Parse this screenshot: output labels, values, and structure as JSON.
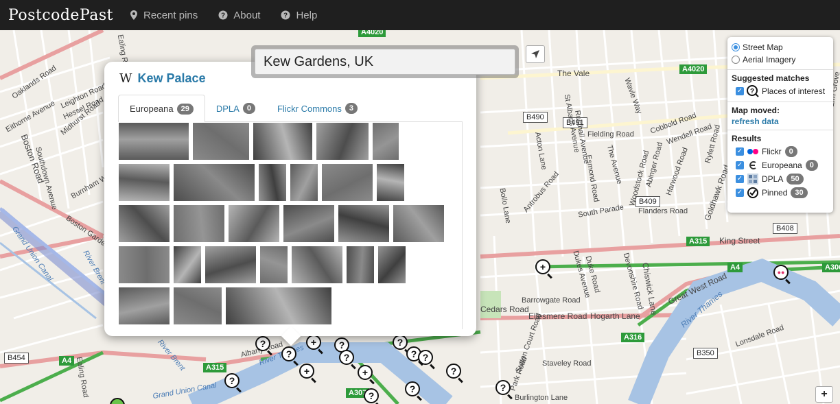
{
  "navbar": {
    "brand": "PostcodePast",
    "items": [
      {
        "label": "Recent pins",
        "icon": "map-marker-icon"
      },
      {
        "label": "About",
        "icon": "question-circle-icon"
      },
      {
        "label": "Help",
        "icon": "question-circle-icon"
      }
    ]
  },
  "search": {
    "value": "Kew Gardens, UK"
  },
  "popup": {
    "title": "Kew Palace",
    "source_icon": "W",
    "tabs": [
      {
        "label": "Europeana",
        "count": "29"
      },
      {
        "label": "DPLA",
        "count": "0"
      },
      {
        "label": "Flickr Commons",
        "count": "3"
      }
    ]
  },
  "layers": {
    "base": [
      {
        "label": "Street Map",
        "selected": true
      },
      {
        "label": "Aerial Imagery",
        "selected": false
      }
    ],
    "suggested_title": "Suggested matches",
    "suggested": [
      {
        "label": "Places of interest",
        "checked": true
      }
    ],
    "moved_title": "Map moved:",
    "refresh_label": "refresh data",
    "results_title": "Results",
    "results": [
      {
        "label": "Flickr",
        "count": "0",
        "icon": "flickr-icon"
      },
      {
        "label": "Europeana",
        "count": "0",
        "icon": "europeana-icon"
      },
      {
        "label": "DPLA",
        "count": "50",
        "icon": "dpla-icon"
      },
      {
        "label": "Pinned",
        "count": "30",
        "icon": "pinned-icon"
      }
    ]
  },
  "map": {
    "road_labels": [
      "A4020",
      "The Vale",
      "B490",
      "B491",
      "B409",
      "B408",
      "A315",
      "A4",
      "A306",
      "A316",
      "B350",
      "B454",
      "A4",
      "A315",
      "A307",
      "A4020"
    ],
    "streets": [
      "Oaklands Road",
      "Leighton Road",
      "Hessel Road",
      "Midhurst Road",
      "Eithorne Avenue",
      "Boston Road",
      "Southdown Avenue",
      "Burnham Way",
      "Boston Gardens",
      "Grand Union Canal",
      "River Brent",
      "Acton Lane",
      "Antrobus Road",
      "South Parade",
      "Flanders Road",
      "King Street",
      "Chiswick Lane",
      "Great West Road",
      "Ellesmere Road",
      "Hogarth Lane",
      "Cedars Road",
      "Barrowgate Road",
      "Burlington Lane",
      "Lonsdale Road",
      "Goldhawk Road",
      "Fielding Road",
      "The Avenue",
      "Albany Road",
      "Esmond Road",
      "Woodstock Road",
      "Abinger Road",
      "Cobbold Road",
      "Wendell Road",
      "Rylett Road",
      "Harwood Road",
      "Elm Grove",
      "Devonshire Road",
      "Duke Road",
      "Park Road",
      "Staveley Road",
      "Sutton Court Road",
      "St Albans Avenue",
      "Rusthall Avenue",
      "Dukes Avenue",
      "Wavle Way",
      "Bollo Lane",
      "Ealing Road",
      "Ealing Road"
    ],
    "water_labels": [
      "River Thames",
      "River Thames",
      "River Brent",
      "Grand Union Canal"
    ]
  },
  "zoom": {
    "in_label": "+"
  }
}
